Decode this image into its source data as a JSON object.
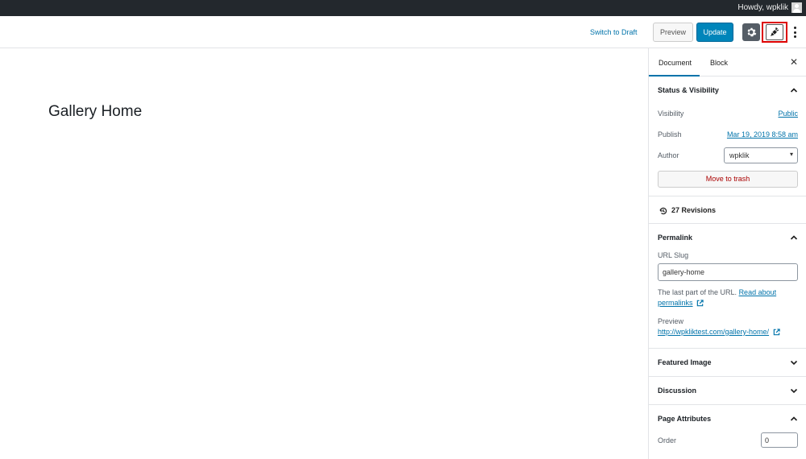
{
  "admin_bar": {
    "greeting": "Howdy, wpklik"
  },
  "header": {
    "switch_to_draft": "Switch to Draft",
    "preview": "Preview",
    "update": "Update",
    "settings_icon": "gear-icon",
    "plugin_icon": "carrot-icon",
    "more_icon": "more-vertical-icon"
  },
  "content": {
    "post_title": "Gallery Home"
  },
  "sidebar": {
    "tabs": [
      "Document",
      "Block"
    ],
    "close_icon": "close-icon",
    "status_visibility": {
      "title": "Status & Visibility",
      "visibility_label": "Visibility",
      "visibility_value": "Public",
      "publish_label": "Publish",
      "publish_value": "Mar 19, 2019 8:58 am",
      "author_label": "Author",
      "author_value": "wpklik",
      "trash": "Move to trash"
    },
    "revisions": "27 Revisions",
    "permalink": {
      "title": "Permalink",
      "slug_label": "URL Slug",
      "slug_value": "gallery-home",
      "help_text": "The last part of the URL.",
      "help_link_1": "Read about",
      "help_link_2": "permalinks",
      "preview_label": "Preview",
      "preview_url": "http://wpkliktest.com/gallery-home/"
    },
    "featured_image": "Featured Image",
    "discussion": "Discussion",
    "page_attributes": {
      "title": "Page Attributes",
      "order_label": "Order",
      "order_value": "0"
    }
  },
  "colors": {
    "accent": "#0085ba",
    "link": "#0073aa",
    "highlight": "#dd0000",
    "admin_bar": "#23282d"
  }
}
